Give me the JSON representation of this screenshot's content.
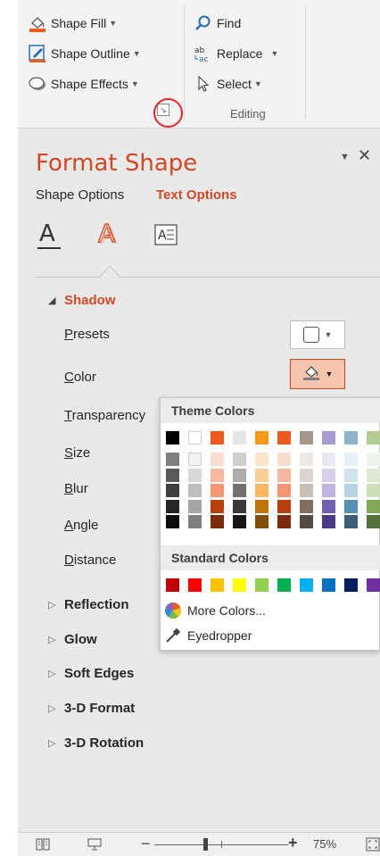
{
  "ribbon": {
    "drawing": {
      "shape_fill": "Shape Fill",
      "shape_outline": "Shape Outline",
      "shape_effects": "Shape Effects"
    },
    "editing": {
      "find": "Find",
      "replace": "Replace",
      "select": "Select",
      "group_label": "Editing"
    }
  },
  "pane": {
    "title": "Format Shape",
    "close_glyph": "✕",
    "dropdown_glyph": "▼",
    "tabs": [
      "Shape Options",
      "Text Options"
    ],
    "active_tab": "Text Options",
    "sub_icons": [
      "text-fill-outline-icon",
      "text-effects-icon",
      "textbox-icon"
    ],
    "active_sub_icon": "text-effects-icon",
    "sections": {
      "shadow": {
        "label": "Shadow",
        "expanded": true,
        "properties": [
          {
            "label": "Presets",
            "key": "P"
          },
          {
            "label": "Color",
            "key": "C"
          },
          {
            "label": "Transparency",
            "key": "T"
          },
          {
            "label": "Size",
            "key": "S"
          },
          {
            "label": "Blur",
            "key": "B"
          },
          {
            "label": "Angle",
            "key": "A"
          },
          {
            "label": "Distance",
            "key": "D"
          }
        ]
      },
      "collapsed": [
        "Reflection",
        "Glow",
        "Soft Edges",
        "3-D Format",
        "3-D Rotation"
      ]
    }
  },
  "color_dropdown": {
    "theme_heading": "Theme Colors",
    "standard_heading": "Standard Colors",
    "more_colors": "More Colors...",
    "eyedropper": "Eyedropper",
    "theme_top": [
      "#000000",
      "#ffffff",
      "#ed5b1f",
      "#e7e6e6",
      "#f79a1a",
      "#ee5b20",
      "#a5978c",
      "#a99bd2",
      "#8db4cc",
      "#b3cc92"
    ],
    "theme_shades": [
      [
        "#7f7f7f",
        "#f2f2f2",
        "#fbdcd0",
        "#d0cece",
        "#fde6c8",
        "#fbdcd1",
        "#ede9e6",
        "#ebe7f5",
        "#e7f0f6",
        "#eef4e7"
      ],
      [
        "#595959",
        "#d9d9d9",
        "#f8b9a1",
        "#afabab",
        "#fbcf95",
        "#f7b8a2",
        "#dbd4cf",
        "#d5cdeb",
        "#cfe1ec",
        "#dde9d0"
      ],
      [
        "#3f3f3f",
        "#bfbfbf",
        "#f49672",
        "#757171",
        "#f9b763",
        "#f49674",
        "#c9bfb7",
        "#c0b4e1",
        "#b8d2e3",
        "#cbdfb8"
      ],
      [
        "#262626",
        "#a6a6a6",
        "#b8400f",
        "#3b3838",
        "#c07508",
        "#b84010",
        "#7f6f63",
        "#7460b2",
        "#5790b4",
        "#81a95a"
      ],
      [
        "#0d0d0d",
        "#7f7f7f",
        "#7b2a0a",
        "#171616",
        "#804e06",
        "#7b2b0b",
        "#554a42",
        "#4a3a86",
        "#3a6078",
        "#56703c"
      ]
    ],
    "standard": [
      "#c00000",
      "#ff0000",
      "#ffc000",
      "#ffff00",
      "#92d050",
      "#00b050",
      "#00b0f0",
      "#0070c0",
      "#002060",
      "#7030a0"
    ]
  },
  "status_bar": {
    "zoom_minus": "−",
    "zoom_plus": "+",
    "zoom_level": "75%",
    "zoom_fraction": 0.38
  },
  "colors": {
    "accent": "#d24726",
    "pane_bg": "#e9e9e9",
    "selected_button_bg": "#f6c5ad",
    "highlight_circle": "#e5252a"
  }
}
